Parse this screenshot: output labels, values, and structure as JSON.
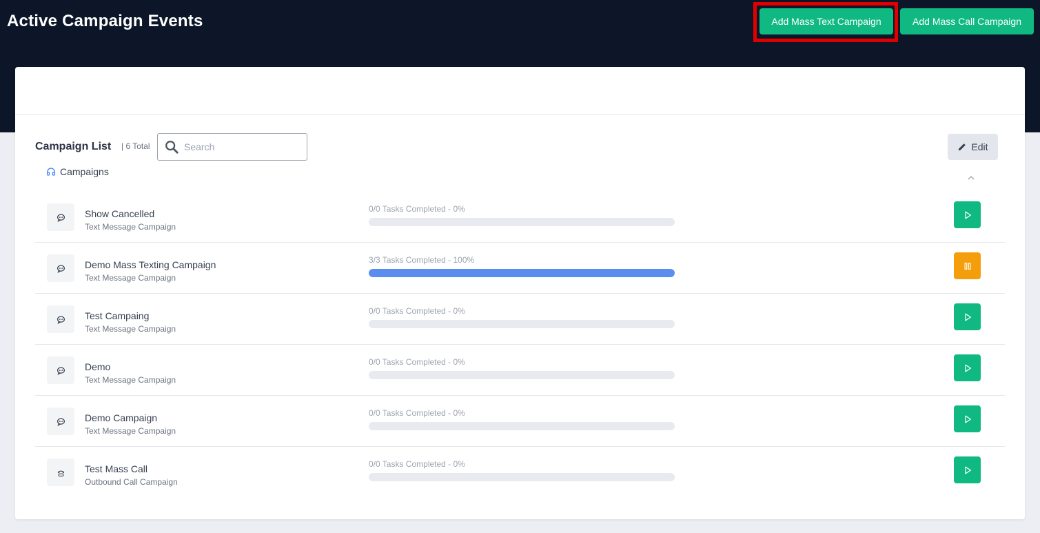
{
  "header": {
    "title": "Active Campaign Events",
    "add_text_label": "Add Mass Text Campaign",
    "add_call_label": "Add Mass Call Campaign"
  },
  "list": {
    "title": "Campaign List",
    "total": "| 6 Total",
    "search_placeholder": "Search",
    "edit_label": "Edit",
    "group_label": "Campaigns"
  },
  "campaigns": [
    {
      "name": "Show Cancelled",
      "type": "Text Message Campaign",
      "progress": "0/0 Tasks Completed - 0%",
      "percent": 0,
      "icon": "message-icon",
      "state": "play"
    },
    {
      "name": "Demo Mass Texting Campaign",
      "type": "Text Message Campaign",
      "progress": "3/3 Tasks Completed - 100%",
      "percent": 100,
      "icon": "message-icon",
      "state": "pause"
    },
    {
      "name": "Test Campaing",
      "type": "Text Message Campaign",
      "progress": "0/0 Tasks Completed - 0%",
      "percent": 0,
      "icon": "message-icon",
      "state": "play"
    },
    {
      "name": "Demo",
      "type": "Text Message Campaign",
      "progress": "0/0 Tasks Completed - 0%",
      "percent": 0,
      "icon": "message-icon",
      "state": "play"
    },
    {
      "name": "Demo Campaign",
      "type": "Text Message Campaign",
      "progress": "0/0 Tasks Completed - 0%",
      "percent": 0,
      "icon": "message-icon",
      "state": "play"
    },
    {
      "name": "Test Mass Call",
      "type": "Outbound Call Campaign",
      "progress": "0/0 Tasks Completed - 0%",
      "percent": 0,
      "icon": "phone-icon",
      "state": "play"
    }
  ],
  "colors": {
    "header_bg": "#0c1628",
    "accent_green": "#10b981",
    "pause_orange": "#f59e0b",
    "progress_blue": "#5b8def",
    "highlight_red": "#e10000"
  }
}
